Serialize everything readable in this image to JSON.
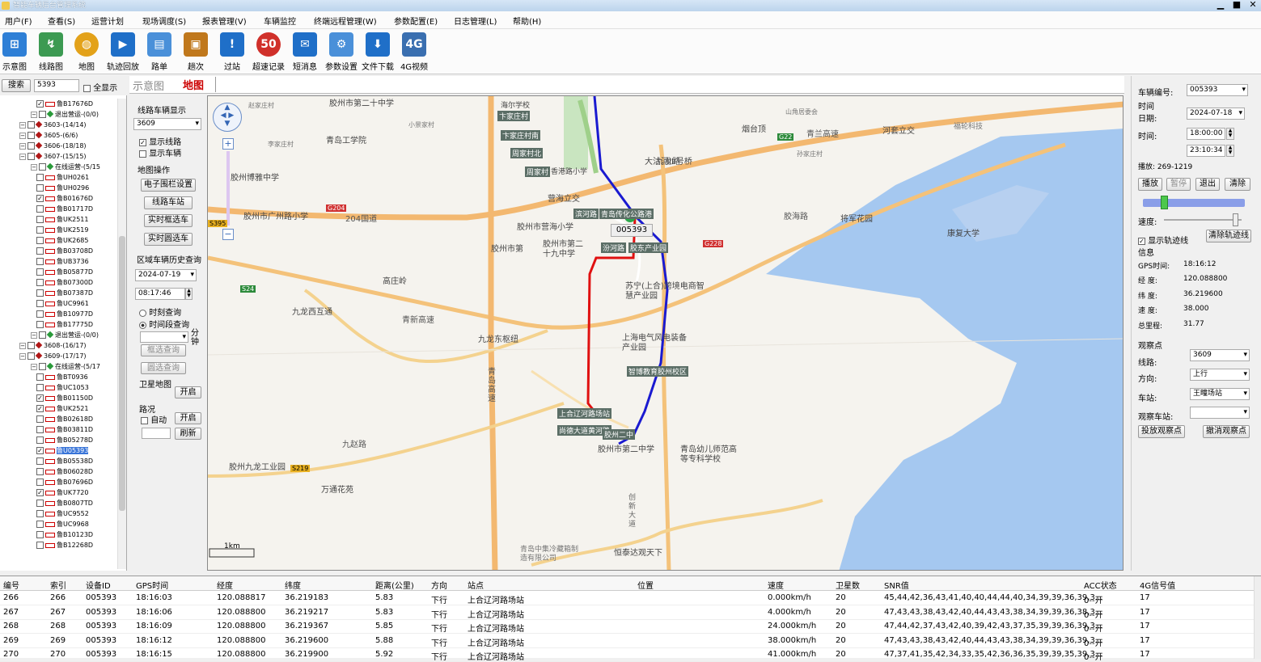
{
  "window": {
    "title": "智能车辆后台管理系统",
    "min": "▁",
    "max": "■",
    "close": "✕"
  },
  "menu": [
    "用户(F)",
    "查看(S)",
    "运营计划",
    "现场调度(S)",
    "报表管理(V)",
    "车辆监控",
    "终端远程管理(W)",
    "参数配置(E)",
    "日志管理(L)",
    "帮助(H)"
  ],
  "toolbar": [
    {
      "label": "示意图",
      "icon": "schematic-icon",
      "color": "#2e7fd6"
    },
    {
      "label": "线路图",
      "icon": "route-map-icon",
      "color": "#3c9a52"
    },
    {
      "label": "地图",
      "icon": "globe-icon",
      "color": "#e3a21a"
    },
    {
      "label": "轨迹回放",
      "icon": "play-icon",
      "color": "#1f6fc8"
    },
    {
      "label": "路单",
      "icon": "waybill-icon",
      "color": "#4a90d9"
    },
    {
      "label": "趟次",
      "icon": "trips-icon",
      "color": "#c0781c"
    },
    {
      "label": "过站",
      "icon": "alert-icon",
      "color": "#1f6fc8"
    },
    {
      "label": "超速记录",
      "icon": "speed-limit-icon",
      "color": "#d0302a"
    },
    {
      "label": "短消息",
      "icon": "message-icon",
      "color": "#1f6fc8"
    },
    {
      "label": "参数设置",
      "icon": "settings-icon",
      "color": "#4a90d9"
    },
    {
      "label": "文件下载",
      "icon": "download-icon",
      "color": "#1f6fc8"
    },
    {
      "label": "4G视频",
      "icon": "video-icon",
      "color": "#3a6fb0"
    }
  ],
  "search": {
    "button": "搜索",
    "value": "5393",
    "showall": "全显示"
  },
  "tree": [
    {
      "t": "bus",
      "label": "鲁B17676D",
      "checked": true,
      "indent": 5
    },
    {
      "t": "green",
      "label": "退出营运-(0/0)",
      "indent": 4
    },
    {
      "t": "red",
      "label": "3603-(14/14)",
      "indent": 2
    },
    {
      "t": "red",
      "label": "3605-(6/6)",
      "indent": 2
    },
    {
      "t": "red",
      "label": "3606-(18/18)",
      "indent": 2
    },
    {
      "t": "red",
      "label": "3607-(15/15)",
      "indent": 2
    },
    {
      "t": "green",
      "label": "在线运营-(5/15",
      "indent": 4
    },
    {
      "t": "bus",
      "label": "鲁UH0261",
      "indent": 5
    },
    {
      "t": "bus",
      "label": "鲁UH0296",
      "indent": 5
    },
    {
      "t": "bus",
      "label": "鲁B01676D",
      "checked": true,
      "indent": 5
    },
    {
      "t": "bus",
      "label": "鲁B01717D",
      "indent": 5
    },
    {
      "t": "bus",
      "label": "鲁UK2511",
      "indent": 5
    },
    {
      "t": "bus",
      "label": "鲁UK2519",
      "indent": 5
    },
    {
      "t": "bus",
      "label": "鲁UK2685",
      "indent": 5
    },
    {
      "t": "bus",
      "label": "鲁B03708D",
      "indent": 5
    },
    {
      "t": "bus",
      "label": "鲁UB3736",
      "indent": 5
    },
    {
      "t": "bus",
      "label": "鲁B05877D",
      "indent": 5
    },
    {
      "t": "bus",
      "label": "鲁B07300D",
      "indent": 5
    },
    {
      "t": "bus",
      "label": "鲁B07387D",
      "indent": 5
    },
    {
      "t": "bus",
      "label": "鲁UC9961",
      "indent": 5
    },
    {
      "t": "bus",
      "label": "鲁B10977D",
      "indent": 5
    },
    {
      "t": "bus",
      "label": "鲁B17775D",
      "indent": 5
    },
    {
      "t": "green",
      "label": "退出营运-(0/0)",
      "indent": 4
    },
    {
      "t": "red",
      "label": "3608-(16/17)",
      "indent": 2
    },
    {
      "t": "red",
      "label": "3609-(17/17)",
      "indent": 2
    },
    {
      "t": "green",
      "label": "在线运营-(5/17",
      "indent": 4
    },
    {
      "t": "bus",
      "label": "鲁BT0936",
      "indent": 5
    },
    {
      "t": "bus",
      "label": "鲁UC1053",
      "indent": 5
    },
    {
      "t": "bus",
      "label": "鲁B01150D",
      "checked": true,
      "indent": 5
    },
    {
      "t": "bus",
      "label": "鲁UK2521",
      "checked": true,
      "indent": 5
    },
    {
      "t": "bus",
      "label": "鲁B02618D",
      "indent": 5
    },
    {
      "t": "bus",
      "label": "鲁B03811D",
      "indent": 5
    },
    {
      "t": "bus",
      "label": "鲁B05278D",
      "indent": 5
    },
    {
      "t": "bus",
      "label": "鲁U05393",
      "checked": true,
      "selected": true,
      "indent": 5
    },
    {
      "t": "bus",
      "label": "鲁B05538D",
      "indent": 5
    },
    {
      "t": "bus",
      "label": "鲁B06028D",
      "indent": 5
    },
    {
      "t": "bus",
      "label": "鲁B07696D",
      "indent": 5
    },
    {
      "t": "bus",
      "label": "鲁UK7720",
      "checked": true,
      "indent": 5
    },
    {
      "t": "bus",
      "label": "鲁B0807TD",
      "indent": 5
    },
    {
      "t": "bus",
      "label": "鲁UC9552",
      "indent": 5
    },
    {
      "t": "bus",
      "label": "鲁UC9968",
      "indent": 5
    },
    {
      "t": "bus",
      "label": "鲁B10123D",
      "indent": 5
    },
    {
      "t": "bus",
      "label": "鲁B12268D",
      "indent": 5
    }
  ],
  "tabs": {
    "schematic": "示意图",
    "map": "地图"
  },
  "mid": {
    "route_vehicle_title": "线路车辆显示",
    "route_select": "3609",
    "show_route": "显示线路",
    "show_vehicle": "显示车辆",
    "map_ops": "地图操作",
    "fence": "电子围栏设置",
    "stations": "线路车站",
    "rect_select": "实时框选车",
    "circle_select": "实时圆选车",
    "history_title": "区域车辆历史查询",
    "date": "2024-07-19",
    "time": "08:17:46",
    "moment": "时刻查询",
    "period": "时间段查询",
    "minutes_label": "分钟",
    "rect_query": "框选查询",
    "circle_query": "圆选查询",
    "satellite": "卫星地图",
    "open": "开启",
    "traffic": "路况",
    "auto": "自动",
    "open2": "开启",
    "refresh": "刷新"
  },
  "map": {
    "scale": "1km",
    "vehicle_label": "005393",
    "station_labels": [
      "卞家庄村",
      "卞家庄村南",
      "周家村北",
      "周家村",
      "滨河路",
      "青岛传化公路港",
      "汾河路",
      "胶东产业园",
      "智博教育胶州校区",
      "上合辽河路场站",
      "尚德大道黄河路",
      "胶州二中"
    ],
    "place_labels": [
      "胶州市第",
      "胶州市广州路小学",
      "胶州博雅中学",
      "青岛工学院",
      "小景家村",
      "李家庄村",
      "胶州市营海小学",
      "胶州市第二十九中学",
      "高庄岭",
      "九龙西互通",
      "九龙东枢纽",
      "苏宁(上合)跨境电商智慧产业园",
      "上海电气风电装备产业园",
      "胶州市第二中学",
      "青岛幼儿师范高等专科学校",
      "万通花苑",
      "胶州九龙工业园",
      "烟台顶",
      "河套立交",
      "福轮科技",
      "大沽河III号桥",
      "将军花园",
      "康复大学",
      "营海立交",
      "胶州市第二十中学",
      "青岛中集冷藏箱制造有限公司",
      "恒泰达观天下",
      "创新大道",
      "香港路小学",
      "海尔学校",
      "山角居委会",
      "孙家庄村",
      "赵家庄村"
    ],
    "road_labels": [
      "G204",
      "G22",
      "S395",
      "S24",
      "G228",
      "S219",
      "204国道",
      "青兰高速",
      "青新高速",
      "九龙路",
      "青岛高速",
      "胶海路",
      "九赵路"
    ]
  },
  "right": {
    "vehicle_no_label": "车辆编号:",
    "vehicle_no": "005393",
    "time_section": "时间",
    "date_label": "日期:",
    "date": "2024-07-18",
    "time_label": "时间:",
    "time_from": "18:00:00",
    "time_to": "23:10:34",
    "playback": "播放: 269-1219",
    "play": "播放",
    "pause": "暂停",
    "exit": "退出",
    "clear": "清除",
    "speed_label": "速度:",
    "show_track": "显示轨迹线",
    "clear_track": "清除轨迹线",
    "info": "信息",
    "gps_time_label": "GPS时间:",
    "gps_time": "18:16:12",
    "lng_label": "经  度:",
    "lng": "120.088800",
    "lat_label": "纬  度:",
    "lat": "36.219600",
    "speed2_label": "速  度:",
    "speed": "38.000",
    "mileage_label": "总里程:",
    "mileage": "31.77",
    "observe": "观察点",
    "line_label": "线路:",
    "line": "3609",
    "dir_label": "方向:",
    "dir": "上行",
    "station_label": "车站:",
    "station": "王疃场站",
    "obs_station_label": "观察车站:",
    "obs_station": "",
    "put_obs": "投放观察点",
    "cancel_obs": "撤消观察点",
    "slider_progress": 0.07,
    "speed_slider": 0.95
  },
  "table": {
    "headers": [
      "编号",
      "索引",
      "设备ID",
      "GPS时间",
      "经度",
      "纬度",
      "距离(公里)",
      "方向",
      "站点",
      "位置",
      "速度",
      "卫星数",
      "SNR值",
      "ACC状态",
      "4G信号值"
    ],
    "rows": [
      [
        "266",
        "266",
        "005393",
        "18:16:03",
        "120.088817",
        "36.219183",
        "5.83",
        "下行",
        "上合辽河路场站",
        "",
        "0.000km/h",
        "20",
        "45,44,42,36,43,41,40,40,44,44,40,34,39,39,36,39,3...",
        "0--开",
        "17"
      ],
      [
        "267",
        "267",
        "005393",
        "18:16:06",
        "120.088800",
        "36.219217",
        "5.83",
        "下行",
        "上合辽河路场站",
        "",
        "4.000km/h",
        "20",
        "47,43,43,38,43,42,40,44,43,43,38,34,39,39,36,38,3...",
        "0--开",
        "17"
      ],
      [
        "268",
        "268",
        "005393",
        "18:16:09",
        "120.088800",
        "36.219367",
        "5.85",
        "下行",
        "上合辽河路场站",
        "",
        "24.000km/h",
        "20",
        "47,44,42,37,43,42,40,39,42,43,37,35,39,39,36,39,3...",
        "0--开",
        "17"
      ],
      [
        "269",
        "269",
        "005393",
        "18:16:12",
        "120.088800",
        "36.219600",
        "5.88",
        "下行",
        "上合辽河路场站",
        "",
        "38.000km/h",
        "20",
        "47,43,43,38,43,42,40,44,43,43,38,34,39,39,36,39,3...",
        "0--开",
        "17"
      ],
      [
        "270",
        "270",
        "005393",
        "18:16:15",
        "120.088800",
        "36.219900",
        "5.92",
        "下行",
        "上合辽河路场站",
        "",
        "41.000km/h",
        "20",
        "47,37,41,35,42,34,33,35,42,36,36,35,39,39,35,39,3...",
        "0--开",
        "17"
      ]
    ]
  }
}
